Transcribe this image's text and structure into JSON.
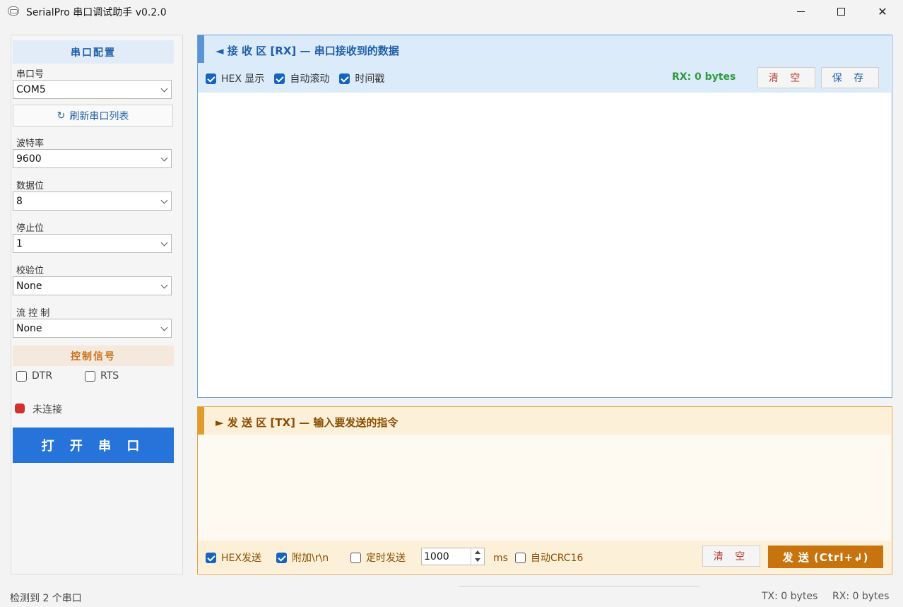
{
  "window": {
    "title": "SerialPro 串口调试助手 v0.2.0",
    "minimize": "—",
    "maximize": "□",
    "close": "✕"
  },
  "left": {
    "port_config_title": "串口配置",
    "port_label": "串口号",
    "port_value": "COM5",
    "refresh_icon": "↻",
    "refresh_label": "刷新串口列表",
    "baud_label": "波特率",
    "baud_value": "9600",
    "databits_label": "数据位",
    "databits_value": "8",
    "stopbits_label": "停止位",
    "stopbits_value": "1",
    "parity_label": "校验位",
    "parity_value": "None",
    "flow_label": "流 控 制",
    "flow_value": "None",
    "control_signal_title": "控制信号",
    "dtr_label": "DTR",
    "dtr_checked": false,
    "rts_label": "RTS",
    "rts_checked": false,
    "status_text": "未连接",
    "status_color": "#d32f2f",
    "open_button": "打 开 串 口"
  },
  "rx": {
    "title": "◄  接 收 区  [RX]  — 串口接收到的数据",
    "hex_display": "HEX 显示",
    "hex_display_checked": true,
    "auto_scroll": "自动滚动",
    "auto_scroll_checked": true,
    "timestamp": "时间戳",
    "timestamp_checked": true,
    "count": "RX: 0 bytes",
    "clear_button": "清 空",
    "save_button": "保 存",
    "content": ""
  },
  "tx": {
    "title": "►  发 送 区  [TX]  — 输入要发送的指令",
    "content": "",
    "hex_send": "HEX发送",
    "hex_send_checked": true,
    "append_crlf": "附加\\r\\n",
    "append_crlf_checked": true,
    "timed_send": "定时发送",
    "timed_send_checked": false,
    "interval_value": "1000",
    "interval_unit": "ms",
    "auto_crc": "自动CRC16",
    "auto_crc_checked": false,
    "clear_button": "清 空",
    "send_button": "发 送  (Ctrl+↲)"
  },
  "statusbar": {
    "detected": "检测到 2 个串口",
    "tx_count": "TX: 0 bytes",
    "rx_count": "RX: 0 bytes"
  },
  "colors": {
    "accent_blue": "#2673d9",
    "rx_accent": "#5a93d6",
    "tx_accent": "#e39b2e",
    "send_button": "#c7740f",
    "rx_count_green": "#2e9b3c"
  }
}
